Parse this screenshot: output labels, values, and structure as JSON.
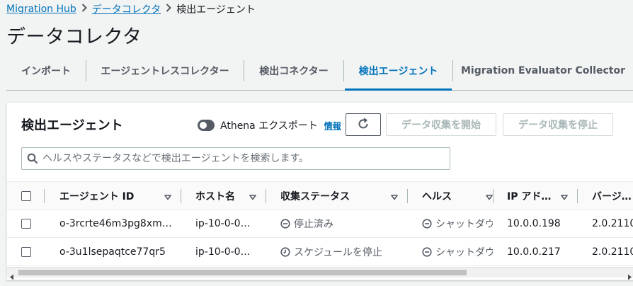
{
  "breadcrumb": {
    "items": [
      "Migration Hub",
      "データコレクタ"
    ],
    "current": "検出エージェント"
  },
  "page_title": "データコレクタ",
  "tabs": [
    {
      "label": "インポート",
      "active": false
    },
    {
      "label": "エージェントレスコレクター",
      "active": false
    },
    {
      "label": "検出コネクター",
      "active": false
    },
    {
      "label": "検出エージェント",
      "active": true
    },
    {
      "label": "Migration Evaluator Collector",
      "active": false
    }
  ],
  "panel": {
    "title": "検出エージェント",
    "athena_toggle_label": "Athena エクスポート",
    "info_label": "情報",
    "start_button": "データ収集を開始",
    "stop_button": "データ収集を停止",
    "search_placeholder": "ヘルスやステータスなどで検出エージェントを検索します。"
  },
  "table": {
    "columns": [
      "エージェント ID",
      "ホスト名",
      "収集ステータス",
      "ヘルス",
      "IP アド…",
      "バージ…"
    ],
    "rows": [
      {
        "agent_id": "o-3rcrte46m3pg8xm…",
        "hostname": "ip-10-0-0…",
        "status": "停止済み",
        "status_icon": "stop-circle-icon",
        "health": "シャットダウン",
        "ip": "10.0.0.198",
        "version": "2.0.2110"
      },
      {
        "agent_id": "o-3u1lsepaqtce77qr5",
        "hostname": "ip-10-0-0…",
        "status": "スケジュールを停止",
        "status_icon": "clock-icon",
        "health": "シャットダウン",
        "ip": "10.0.0.217",
        "version": "2.0.2110"
      }
    ]
  },
  "colors": {
    "link": "#0073bb",
    "text": "#16191f",
    "muted": "#545b64",
    "border": "#aab7b8",
    "disabled": "#aab7b8"
  }
}
